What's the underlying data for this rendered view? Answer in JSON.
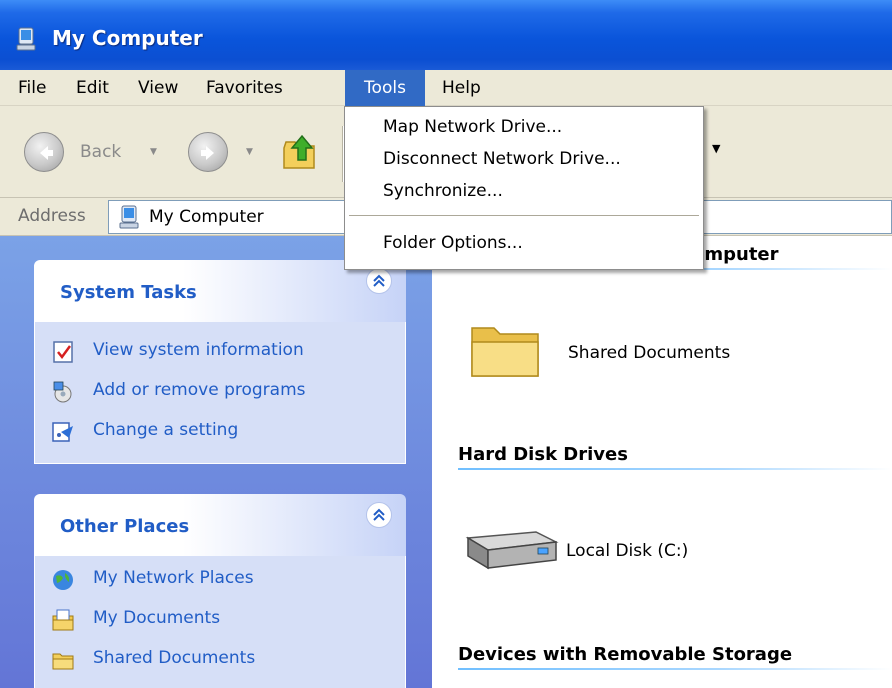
{
  "window": {
    "title": "My Computer",
    "icon": "computer-icon"
  },
  "menu": {
    "items": [
      "File",
      "Edit",
      "View",
      "Favorites",
      "Tools",
      "Help"
    ],
    "active": "Tools"
  },
  "toolbar": {
    "back_label": "Back"
  },
  "address": {
    "label": "Address",
    "value": "My Computer"
  },
  "tools_menu": {
    "items": [
      "Map Network Drive...",
      "Disconnect Network Drive...",
      "Synchronize...",
      "Folder Options..."
    ]
  },
  "sidebar": {
    "system_tasks": {
      "title": "System Tasks",
      "items": [
        {
          "label": "View system information",
          "icon": "system-info-icon"
        },
        {
          "label": "Add or remove programs",
          "icon": "add-remove-programs-icon"
        },
        {
          "label": "Change a setting",
          "icon": "control-panel-icon"
        }
      ]
    },
    "other_places": {
      "title": "Other Places",
      "items": [
        {
          "label": "My Network Places",
          "icon": "network-places-icon"
        },
        {
          "label": "My Documents",
          "icon": "my-documents-icon"
        },
        {
          "label": "Shared Documents",
          "icon": "folder-icon"
        }
      ]
    }
  },
  "content": {
    "groups": [
      {
        "title": "omputer",
        "items": [
          {
            "label": "Shared Documents",
            "icon": "folder-icon"
          }
        ]
      },
      {
        "title": "Hard Disk Drives",
        "items": [
          {
            "label": "Local Disk (C:)",
            "icon": "hard-disk-icon"
          }
        ]
      },
      {
        "title": "Devices with Removable Storage",
        "items": []
      }
    ]
  },
  "colors": {
    "titlebar": "#0a55db",
    "menu_highlight": "#316ac5",
    "sidebar_link": "#215dc6",
    "sidebar_bg": "#6375d6",
    "chrome": "#ece9d8"
  }
}
